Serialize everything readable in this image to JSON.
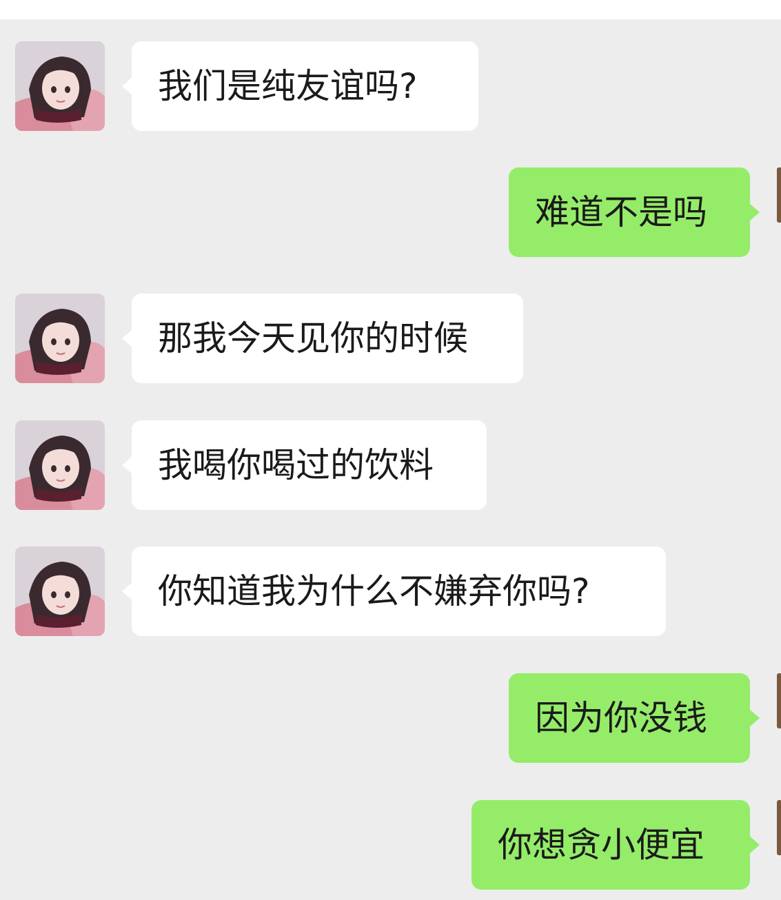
{
  "chat": {
    "messages": [
      {
        "side": "left",
        "text": "我们是纯友谊吗?"
      },
      {
        "side": "right",
        "text": "难道不是吗"
      },
      {
        "side": "left",
        "text": "那我今天见你的时候"
      },
      {
        "side": "left",
        "text": "我喝你喝过的饮料"
      },
      {
        "side": "left",
        "text": "你知道我为什么不嫌弃你吗?"
      },
      {
        "side": "right",
        "text": "因为你没钱"
      },
      {
        "side": "right",
        "text": "你想贪小便宜"
      }
    ]
  },
  "colors": {
    "background": "#ededed",
    "incoming_bubble": "#ffffff",
    "outgoing_bubble": "#95ec69",
    "text": "#1a1a1a"
  },
  "icons": {
    "contact_avatar": "anime-girl-avatar",
    "my_avatar": "user-avatar"
  }
}
